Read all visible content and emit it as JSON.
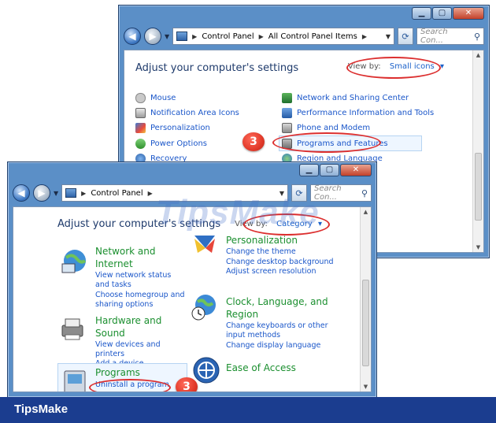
{
  "back_window": {
    "address": [
      "Control Panel",
      "All Control Panel Items"
    ],
    "search_placeholder": "Search Con...",
    "title": "Adjust your computer's settings",
    "view_by_label": "View by:",
    "view_by_value": "Small icons",
    "left_items": [
      "Mouse",
      "Notification Area Icons",
      "Personalization",
      "Power Options",
      "Recovery"
    ],
    "right_items": [
      "Network and Sharing Center",
      "Performance Information and Tools",
      "Phone and Modem",
      "Programs and Features",
      "Region and Language"
    ]
  },
  "front_window": {
    "address": [
      "Control Panel"
    ],
    "search_placeholder": "Search Con...",
    "title": "Adjust your computer's settings",
    "view_by_label": "View by:",
    "view_by_value": "Category",
    "categories": {
      "network": {
        "head": "Network and Internet",
        "links": [
          "View network status and tasks",
          "Choose homegroup and sharing options"
        ]
      },
      "hardware": {
        "head": "Hardware and Sound",
        "links": [
          "View devices and printers",
          "Add a device"
        ]
      },
      "programs": {
        "head": "Programs",
        "links": [
          "Uninstall a program"
        ]
      },
      "personalization": {
        "head": "Personalization",
        "links": [
          "Change the theme",
          "Change desktop background",
          "Adjust screen resolution"
        ]
      },
      "clock": {
        "head": "Clock, Language, and Region",
        "links": [
          "Change keyboards or other input methods",
          "Change display language"
        ]
      },
      "ease": {
        "head": "Ease of Access",
        "links": []
      }
    }
  },
  "annotations": {
    "step_1": "3",
    "step_2": "3"
  },
  "watermark": "TipsMake",
  "footer": {
    "brand": "TipsMake"
  },
  "colors": {
    "accent_link": "#1a56c9",
    "category_green": "#1b8f2f",
    "annotation_red": "#dc2f2f",
    "footer_bg": "#1b3d8f"
  }
}
